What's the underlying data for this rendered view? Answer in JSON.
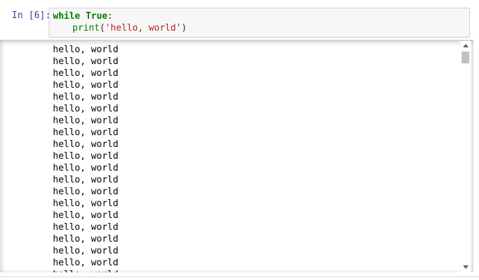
{
  "cell": {
    "prompt": "In [6]:",
    "code": {
      "line1": {
        "keyword": "while",
        "space": " ",
        "constant": "True",
        "colon": ":"
      },
      "line2": {
        "builtin": "print",
        "open": "(",
        "string": "'hello, world'",
        "close": ")"
      }
    }
  },
  "output": {
    "lines": [
      "hello, world",
      "hello, world",
      "hello, world",
      "hello, world",
      "hello, world",
      "hello, world",
      "hello, world",
      "hello, world",
      "hello, world",
      "hello, world",
      "hello, world",
      "hello, world",
      "hello, world",
      "hello, world",
      "hello, world",
      "hello, world",
      "hello, world",
      "hello, world",
      "hello, world",
      "hello, world"
    ]
  },
  "colors": {
    "prompt": "#303f9f",
    "keyword": "#008000",
    "string": "#ba2121",
    "input_bg": "#f7f7f7",
    "scroll_thumb": "#c1c1c1"
  },
  "icons": {
    "scroll_up": "triangle-up-icon",
    "scroll_down": "triangle-down-icon"
  }
}
